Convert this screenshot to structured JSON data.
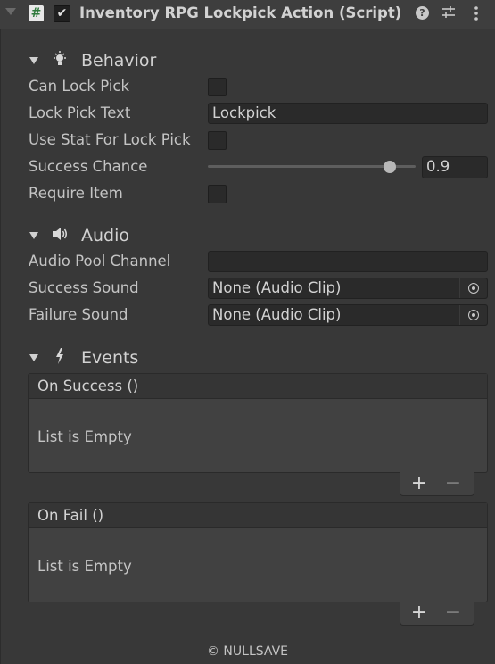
{
  "header": {
    "title": "Inventory RPG Lockpick Action (Script)",
    "script_icon": "#",
    "enabled_check": "✔",
    "help_icon": "?",
    "preset_icon": "preset-icon",
    "menu_icon": "⋮"
  },
  "behavior": {
    "section_label": "Behavior",
    "section_icon": "💡",
    "can_lock_pick_label": "Can Lock Pick",
    "can_lock_pick": false,
    "lock_pick_text_label": "Lock Pick Text",
    "lock_pick_text_value": "Lockpick",
    "use_stat_label": "Use Stat For Lock Pick",
    "use_stat": false,
    "success_chance_label": "Success Chance",
    "success_chance_value": "0.9",
    "success_chance_fraction": 0.9,
    "require_item_label": "Require Item",
    "require_item": false
  },
  "audio": {
    "section_label": "Audio",
    "section_icon": "🔊",
    "pool_channel_label": "Audio Pool Channel",
    "pool_channel_value": "",
    "success_sound_label": "Success Sound",
    "success_sound_value": "None (Audio Clip)",
    "failure_sound_label": "Failure Sound",
    "failure_sound_value": "None (Audio Clip)"
  },
  "events": {
    "section_label": "Events",
    "section_icon": "ϟ",
    "on_success_label": "On Success ()",
    "on_success_empty": "List is Empty",
    "on_fail_label": "On Fail ()",
    "on_fail_empty": "List is Empty",
    "add_label": "+",
    "remove_label": "−"
  },
  "footer": {
    "text": "© NULLSAVE"
  },
  "colors": {
    "background": "#383838",
    "field": "#2a2a2a",
    "text": "#c4c4c4"
  }
}
